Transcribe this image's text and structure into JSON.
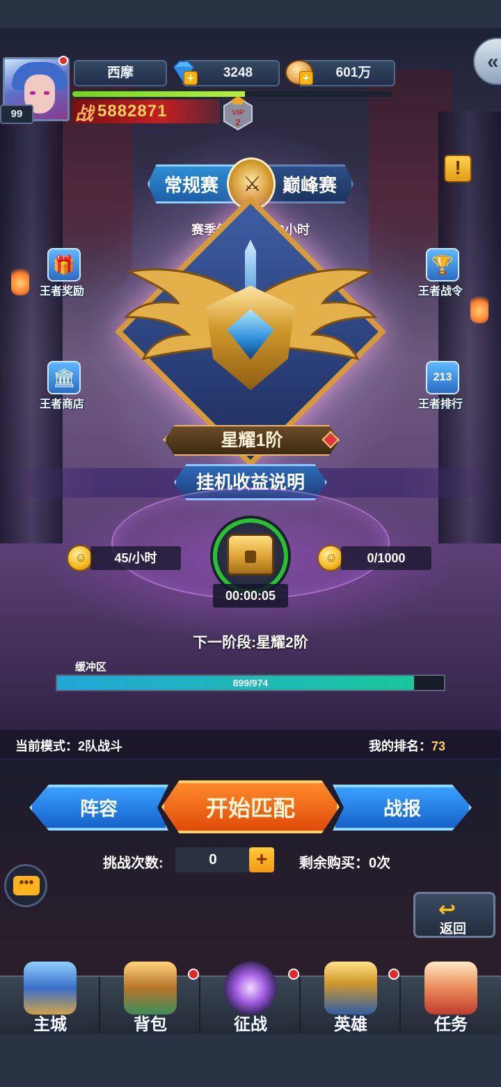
{
  "player": {
    "name": "西摩",
    "level": "99",
    "power_label": "战",
    "power": "5882871",
    "vip_label": "VIP",
    "vip_level": "2",
    "xp_fraction": 0.54
  },
  "currency": {
    "diamonds": "3248",
    "gold": "601万"
  },
  "season": {
    "tab_regular": "常规赛",
    "tab_peak": "巅峰赛",
    "countdown": "赛季倒计时:3天0小时"
  },
  "side_menu": {
    "king_reward": "王者奖励",
    "king_battlepass": "王者战令",
    "king_shop": "王者商店",
    "king_ranking": "王者排行",
    "ranking_icon_digits": "213"
  },
  "rank": {
    "current": "星耀1阶",
    "idle_info": "挂机收益说明",
    "rate": "45/小时",
    "stored": "0/1000",
    "timer": "00:00:05",
    "next_stage": "下一阶段:星耀2阶",
    "buffer_label": "缓冲区",
    "progress_text": "899/974",
    "progress_value": 899,
    "progress_max": 974
  },
  "status": {
    "mode": "当前模式：2队战斗",
    "my_rank_label": "我的排名：",
    "my_rank": "73"
  },
  "actions": {
    "lineup": "阵容",
    "start_match": "开始匹配",
    "report": "战报"
  },
  "challenge": {
    "label": "挑战次数:",
    "count": "0",
    "remaining": "剩余购买：0次"
  },
  "return_label": "返回",
  "nav": [
    {
      "label": "主城",
      "badge": false
    },
    {
      "label": "背包",
      "badge": true
    },
    {
      "label": "征战",
      "badge": true
    },
    {
      "label": "英雄",
      "badge": true
    },
    {
      "label": "任务",
      "badge": false
    }
  ],
  "colors": {
    "accent_orange": "#e04b0a",
    "accent_blue": "#1562c8",
    "progress_green": "#19c79b",
    "gold_text": "#ffd15c"
  }
}
